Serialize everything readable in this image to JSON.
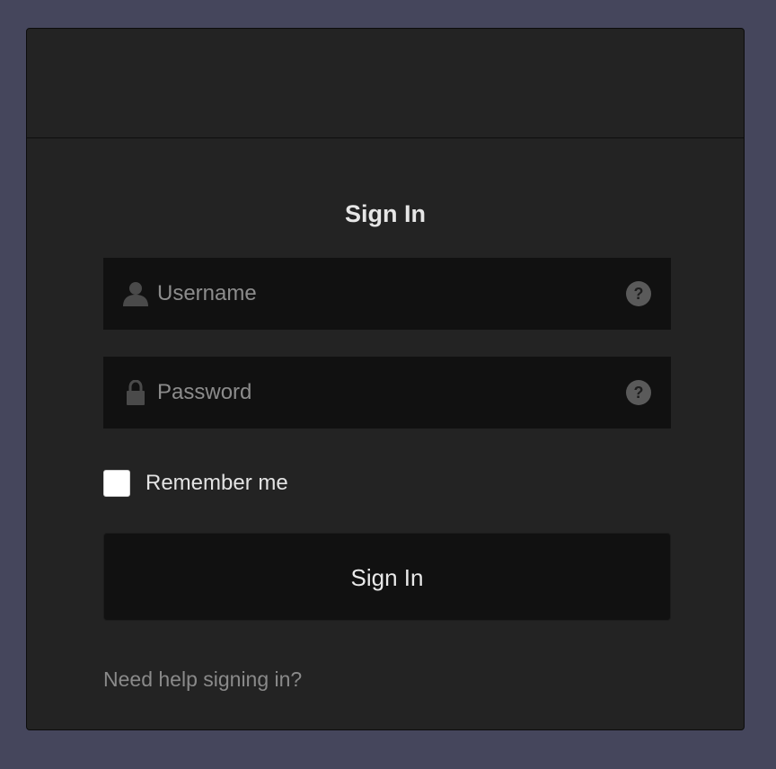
{
  "page": {
    "background": "#45465c",
    "card_background": "#232323",
    "field_background": "#111111"
  },
  "form": {
    "title": "Sign In",
    "username": {
      "placeholder": "Username",
      "value": "",
      "icon": "user-icon",
      "help_icon": "question-circle-icon",
      "help_glyph": "?"
    },
    "password": {
      "placeholder": "Password",
      "value": "",
      "icon": "lock-icon",
      "help_icon": "question-circle-icon",
      "help_glyph": "?"
    },
    "remember": {
      "label": "Remember me",
      "checked": false
    },
    "submit_label": "Sign In",
    "help_link": "Need help signing in?"
  }
}
